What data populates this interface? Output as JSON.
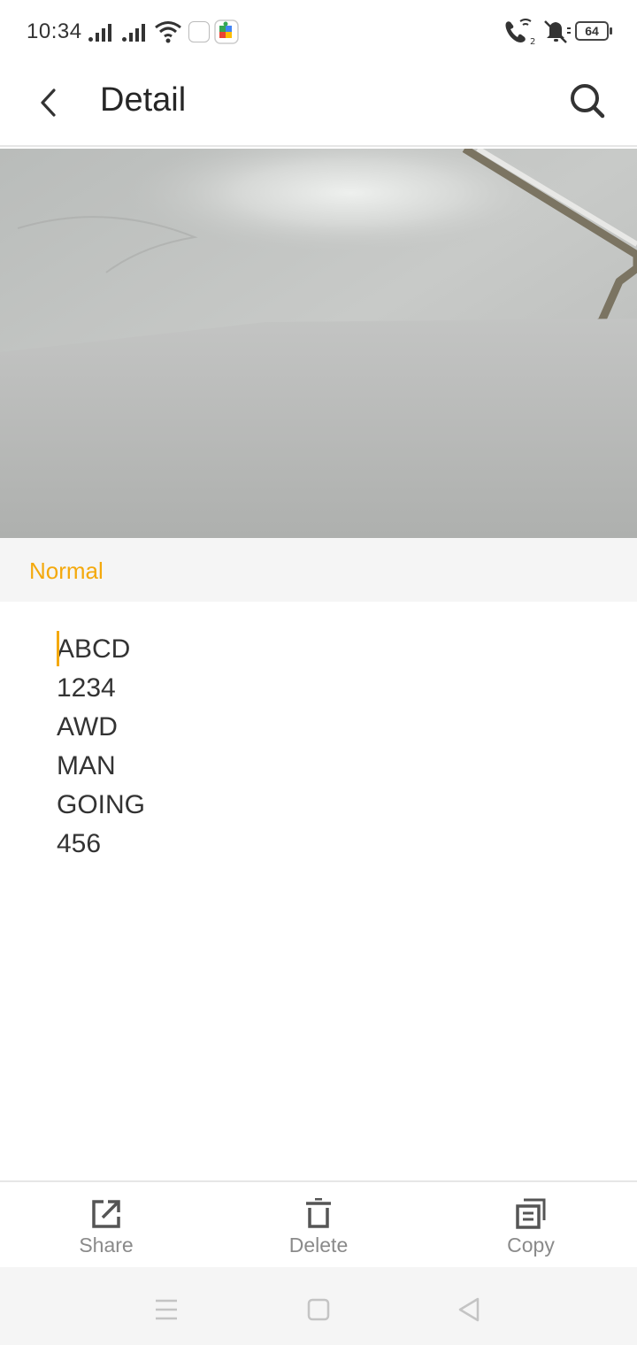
{
  "status_bar": {
    "time": "10:34",
    "battery": "64",
    "icons": [
      "signal-icon",
      "signal-icon",
      "wifi-icon",
      "app-notification-icon",
      "puzzle-app-icon",
      "wifi-calling-icon",
      "vibrate-icon",
      "battery-icon"
    ]
  },
  "header": {
    "title": "Detail",
    "back_icon": "chevron-left-icon",
    "search_icon": "search-icon"
  },
  "filter": {
    "label": "Normal",
    "accent_color": "#f4a90d"
  },
  "recognized_text": {
    "lines": [
      "ABCD",
      "1234",
      "AWD",
      "MAN",
      "GOING",
      "456"
    ]
  },
  "toolbar": {
    "share_label": "Share",
    "delete_label": "Delete",
    "copy_label": "Copy"
  },
  "nav": {
    "icons": [
      "menu-icon",
      "home-icon",
      "back-triangle-icon"
    ]
  }
}
